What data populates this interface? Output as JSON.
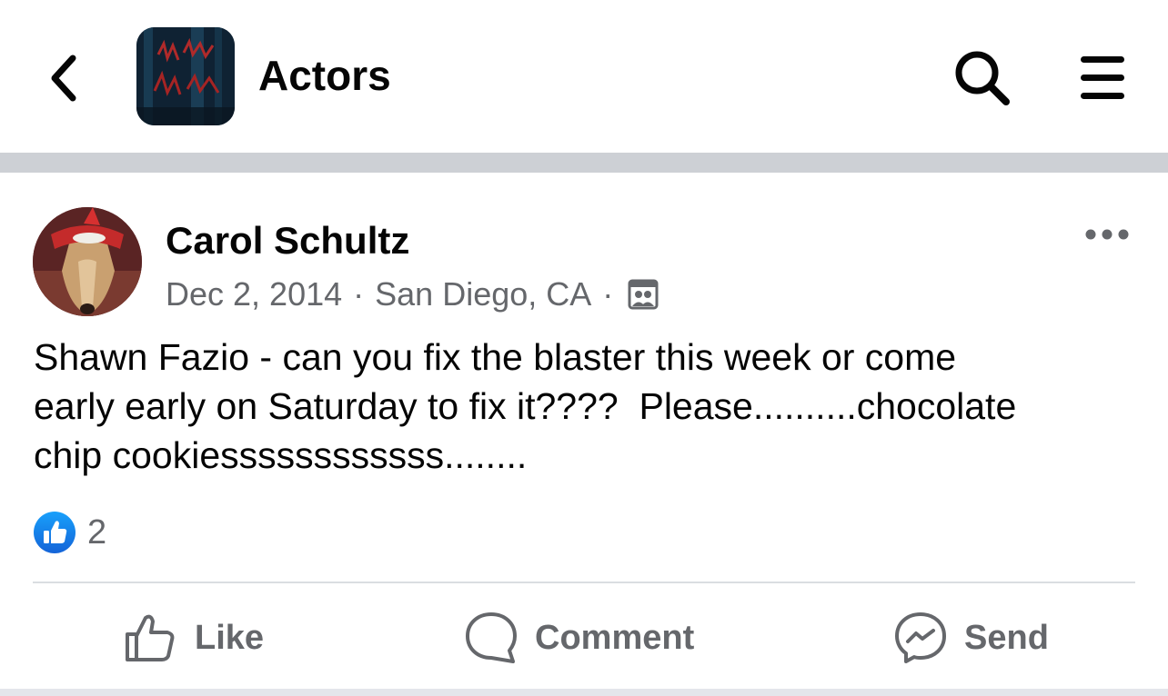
{
  "header": {
    "group_title": "Actors",
    "back_icon": "chevron-left-icon",
    "search_icon": "search-icon",
    "menu_icon": "hamburger-menu-icon"
  },
  "post": {
    "author": "Carol Schultz",
    "date": "Dec 2, 2014",
    "separator": "·",
    "location": "San Diego, CA",
    "audience_icon": "group-audience-icon",
    "more_icon": "more-options-icon",
    "text": "Shawn Fazio - can you fix the blaster this week or come\nearly early on Saturday to fix it????  Please..........chocolate\nchip cookiessssssssssss........",
    "reaction_count": "2",
    "reaction_icon": "like-reaction-icon"
  },
  "actions": {
    "like_label": "Like",
    "comment_label": "Comment",
    "send_label": "Send"
  },
  "colors": {
    "primary_text": "#050505",
    "secondary_text": "#65676b",
    "like_blue": "#1877f2",
    "divider": "#cdd0d5"
  }
}
